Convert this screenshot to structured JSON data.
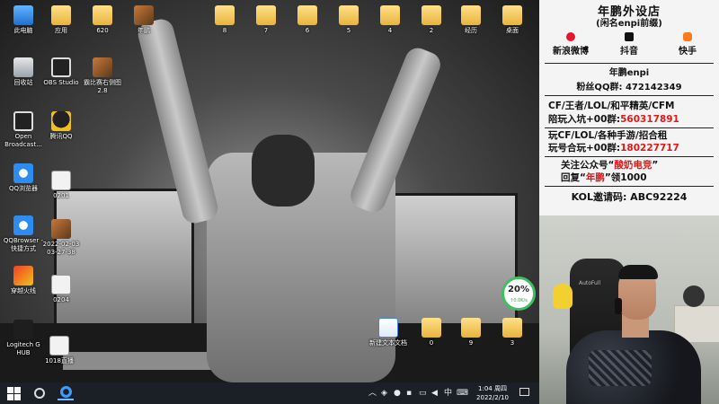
{
  "desktop": {
    "icons": [
      {
        "label": "此电脑",
        "icon": "pc-icon"
      },
      {
        "label": "回收站",
        "icon": "recycle-bin-icon"
      },
      {
        "label": "Open Broadcast...",
        "icon": "obs-icon"
      },
      {
        "label": "QQ浏览器",
        "icon": "browser-icon"
      },
      {
        "label": "QQBrowser - 快捷方式",
        "icon": "browser-icon"
      },
      {
        "label": "穿越火线",
        "icon": "game-icon"
      },
      {
        "label": "Logitech G HUB",
        "icon": "logitech-icon"
      },
      {
        "label": "应用",
        "icon": "folder-icon"
      },
      {
        "label": "OBS Studio",
        "icon": "obs-icon"
      },
      {
        "label": "腾讯QQ",
        "icon": "qq-icon"
      },
      {
        "label": "0201",
        "icon": "file-icon"
      },
      {
        "label": "2022-02-03 03-27-38",
        "icon": "image-icon"
      },
      {
        "label": "0204",
        "icon": "file-icon"
      },
      {
        "label": "620",
        "icon": "folder-icon"
      },
      {
        "label": "霸比赛右侧图 2.8",
        "icon": "image-icon"
      },
      {
        "label": "年鹏",
        "icon": "image-icon"
      },
      {
        "label": "8",
        "icon": "folder-icon"
      },
      {
        "label": "7",
        "icon": "folder-icon"
      },
      {
        "label": "6",
        "icon": "folder-icon"
      },
      {
        "label": "5",
        "icon": "folder-icon"
      },
      {
        "label": "4",
        "icon": "folder-icon"
      },
      {
        "label": "2",
        "icon": "folder-icon"
      },
      {
        "label": "经历",
        "icon": "folder-icon"
      },
      {
        "label": "桌面",
        "icon": "folder-icon"
      },
      {
        "label": "1018直播",
        "icon": "file-icon"
      },
      {
        "label": "新建文本文档",
        "icon": "document-icon"
      },
      {
        "label": "0",
        "icon": "folder-icon"
      },
      {
        "label": "9",
        "icon": "folder-icon"
      },
      {
        "label": "3",
        "icon": "folder-icon"
      }
    ],
    "cpu_gauge": {
      "percent": "20%",
      "speed": "↑0.0K/s"
    }
  },
  "taskbar": {
    "time": "1:04 周四",
    "date": "2022/2/10",
    "ime": "中"
  },
  "panel": {
    "title": "年鹏外设店",
    "subtitle": "(闲名enpi前缀)",
    "social": [
      {
        "label": "新浪微博",
        "icon": "weibo-icon"
      },
      {
        "label": "抖音",
        "icon": "douyin-icon"
      },
      {
        "label": "快手",
        "icon": "kuaishou-icon"
      }
    ],
    "username": "年鹏enpi",
    "fan_group_label": "粉丝QQ群:",
    "fan_group_number": "472142349",
    "games_line": "CF/王者/LOL/和平精英/CFM",
    "group1_label": "陪玩入坑+00群:",
    "group1_number": "560317891",
    "games_line2": "玩CF/LOL/各种手游/招合租",
    "group2_label": "玩号合玩+00群:",
    "group2_number": "180227717",
    "follow_prefix": "关注公众号“",
    "follow_name": "酸奶电竞",
    "follow_suffix": "”",
    "reply_prefix": "回复“",
    "reply_word": "年鹏",
    "reply_suffix": "”领1000",
    "kol": "KOL邀请码: ABC92224"
  },
  "webcam": {
    "chair_brand": "AutoFull"
  }
}
